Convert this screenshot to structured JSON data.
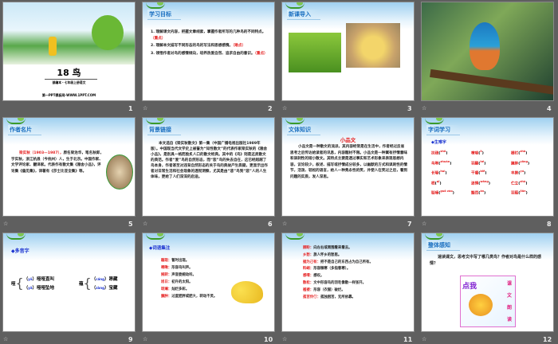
{
  "slides": [
    {
      "number": "1",
      "title": "18 鸟",
      "subtitle": "部编本・七年级上册语文",
      "footer": "第一PPT模板网-WWW.1PPT.COM"
    },
    {
      "number": "2",
      "tag": "学习目标",
      "items": [
        {
          "text": "1. 理解课文内容，把握文章线索，掌握作者所写的几种鸟的不同特点。",
          "note": "（重点）"
        },
        {
          "text": "2. 理解本文描写不同形态的鸟的写法和思想感情。",
          "note": "（难点）"
        },
        {
          "text": "3. 领悟作者对鸟的感情倾向，培养热爱自然、追求自由的意识。",
          "note": "（重点）"
        }
      ]
    },
    {
      "number": "3",
      "tag": "新课导入"
    },
    {
      "number": "4"
    },
    {
      "number": "5",
      "tag": "作者名片",
      "name": "梁实秋（1903—1987），",
      "text": "原名梁治华，笔名秋郎，字实秋，浙江杭县（今杭州）人，生于北京。中国作家、文学评论家、翻译家。代表作有散文集《雅舍小品》，评论集《偏见集》，译著有《莎士比亚全集》等。"
    },
    {
      "number": "6",
      "tag": "背景链接",
      "text": "本文选自《梁实秋散文》第一集（中国广播电视出版社1989年版）。中国现当代文学史上被誉为“知性散文”的代表作家梁实秋的《雅舍小品》，是别具一格而脍炙人口的散文经典。其中的《鸟》则是这类散文的典范。作者“爱”鸟的自然形态，而“悲”鸟的失去自在，这已经超越了鸟本身，作者甚至对违背自然形态的关于鸟的典故产生质疑，更显示出作者对日常生活和社会现象的透彻洞察，尤其是由“悲”鸟到“悲”人的人生体味，更给了人们深深的启迪。"
    },
    {
      "number": "7",
      "tag": "文体知识",
      "heading": "小品文",
      "text": "小品文是一种散文的流派，其内容经常是在生活中，作者经过反省思考之后传达给读者的讯息，内容题材不限。小品文是一种寓有抒情意味和讽刺性的短小散文。其特点主要是透过事实和艺术形象来表现思想内容，议论较少，叙述、描写或抒情成分较多，以幽默的方式和讽刺性的情节，活泼、轻松的语言，给人一种隽永性的笑，并使人在笑过之后，看到问题的实质，发人深思。"
    },
    {
      "number": "8",
      "tag": "字词学习",
      "heading": "◆生难字",
      "words": [
        {
          "w": "扶疏",
          "p": "shū"
        },
        {
          "w": "嘹唳",
          "p": "lì"
        },
        {
          "w": "栅栏",
          "p": "zhà"
        },
        {
          "w": "鸟啭",
          "p": "zhuàn"
        },
        {
          "w": "羽翮",
          "p": "hé"
        },
        {
          "w": "臃肿",
          "p": "yōng"
        },
        {
          "w": "长喙",
          "p": "huì"
        },
        {
          "w": "干瘪",
          "p": "biě"
        },
        {
          "w": "丰腴",
          "p": "yú"
        },
        {
          "w": "栖",
          "p": "qī"
        },
        {
          "w": "迷惘",
          "p": "wǎng"
        },
        {
          "w": "伫立",
          "p": "zhù"
        },
        {
          "w": "聒噪",
          "p": "guō zào"
        },
        {
          "w": "黯然",
          "p": "àn"
        },
        {
          "w": "羽翦",
          "p": "jiǎn"
        }
      ]
    },
    {
      "number": "9",
      "heading": "◆多音字",
      "groups": [
        {
          "char": "哑",
          "items": [
            {
              "p": "yā",
              "w": "哑哑直叫"
            },
            {
              "p": "yǎ",
              "w": "哑哑坠地"
            }
          ]
        },
        {
          "char": "蕴",
          "items": [
            {
              "p": "cáng",
              "w": "昂藏"
            },
            {
              "p": "zàng",
              "w": "宝藏"
            }
          ]
        }
      ]
    },
    {
      "number": "10",
      "heading": "◆词语集注",
      "entries": [
        {
          "t": "蹦现：",
          "d": "暂时出现。"
        },
        {
          "t": "啁啾：",
          "d": "形容鸟叫声。"
        },
        {
          "t": "婉转：",
          "d": "声音委婉动听。"
        },
        {
          "t": "旭日：",
          "d": "初升的太阳。"
        },
        {
          "t": "斑斓：",
          "d": "灿烂多彩。"
        },
        {
          "t": "臃肿：",
          "d": "过度肥胖或肥大，转动不灵。"
        }
      ]
    },
    {
      "number": "11",
      "entries": [
        {
          "t": "顾盼：",
          "d": "向左右或周围看来看去。"
        },
        {
          "t": "乡愁：",
          "d": "旅人怀乡的愁思。"
        },
        {
          "t": "据为己有：",
          "d": "把不是自己的东西占为自己所有。"
        },
        {
          "t": "料峭：",
          "d": "形容微寒（多指春寒）。"
        },
        {
          "t": "感喟：",
          "d": "感叹。"
        },
        {
          "t": "散松：",
          "d": "文中形容鸟的羽毛像散一样张开。"
        },
        {
          "t": "褴褛：",
          "d": "形容（衣服）破烂。"
        },
        {
          "t": "孤苦伶仃：",
          "d": "孤独困苦，无所依靠。"
        }
      ]
    },
    {
      "number": "12",
      "tag": "整体感知",
      "text": "速读课文，思考文中写了哪几类鸟？作者对鸟是什么样的感情？",
      "button": "点我",
      "side": [
        "课",
        "文",
        "朗",
        "读"
      ]
    }
  ]
}
